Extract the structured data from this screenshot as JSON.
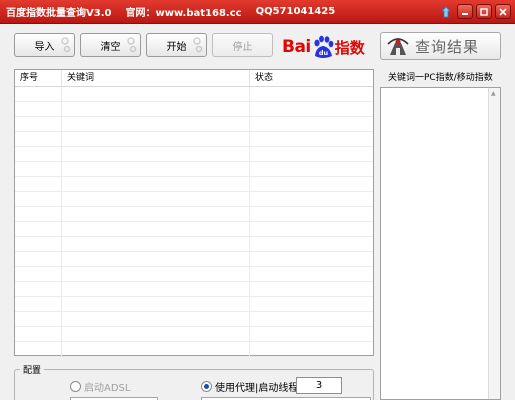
{
  "window": {
    "title": "百度指数批量查询V3.0",
    "website": "官网：www.bat168.cc",
    "qq": "QQ571041425",
    "skin_icon": "skin-icon",
    "minimize_icon": "minimize-icon",
    "maximize_icon": "maximize-icon",
    "close_icon": "close-icon"
  },
  "toolbar": {
    "import_label": "导入",
    "clear_label": "清空",
    "start_label": "开始",
    "stop_label": "停止"
  },
  "logo": {
    "bai": "Bai",
    "du": "du",
    "zhishu": "指数"
  },
  "query_button": {
    "label": "查询结果",
    "icon": "eye-tower-icon"
  },
  "table": {
    "columns": [
      "序号",
      "关键词",
      "状态"
    ],
    "rows": []
  },
  "right_panel": {
    "label": "关键词一PC指数/移动指数",
    "items": []
  },
  "config": {
    "title": "配置",
    "adsl_label": "启动ADSL",
    "proxy_label": "使用代理|启动线程",
    "threads": "3"
  },
  "colors": {
    "titlebar": "#c8201a",
    "baidu_red": "#e10602",
    "baidu_blue": "#2932e1"
  }
}
